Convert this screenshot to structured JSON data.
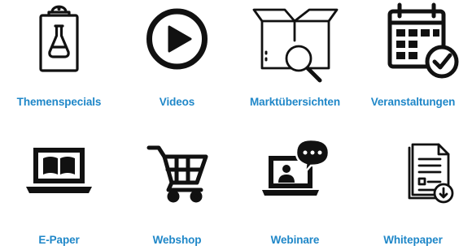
{
  "colors": {
    "label": "#1f87c8",
    "icon": "#111111"
  },
  "tiles": [
    {
      "label": "Themenspecials",
      "icon": "clipboard-flask-icon"
    },
    {
      "label": "Videos",
      "icon": "play-icon"
    },
    {
      "label": "Marktübersichten",
      "icon": "box-search-icon"
    },
    {
      "label": "Veranstaltungen",
      "icon": "calendar-check-icon"
    },
    {
      "label": "E-Paper",
      "icon": "laptop-book-icon"
    },
    {
      "label": "Webshop",
      "icon": "shopping-cart-icon"
    },
    {
      "label": "Webinare",
      "icon": "laptop-chat-icon"
    },
    {
      "label": "Whitepaper",
      "icon": "document-download-icon"
    }
  ]
}
